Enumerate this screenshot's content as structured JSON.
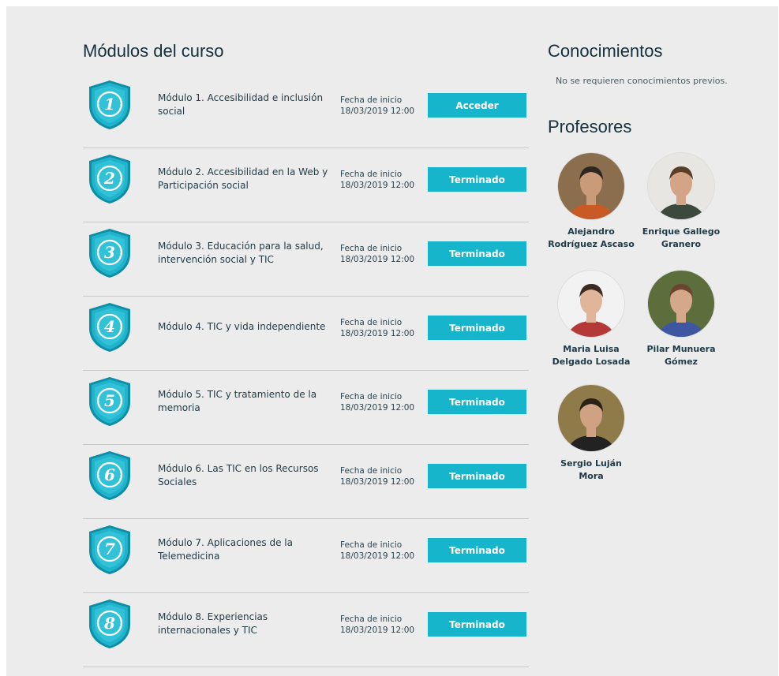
{
  "modules_section": {
    "title": "Módulos del curso",
    "date_label": "Fecha de inicio",
    "modules": [
      {
        "number": "1",
        "title": "Módulo 1. Accesibilidad e inclusión social",
        "date": "18/03/2019 12:00",
        "button": "Acceder"
      },
      {
        "number": "2",
        "title": "Módulo 2. Accesibilidad en la Web y Participación social",
        "date": "18/03/2019 12:00",
        "button": "Terminado"
      },
      {
        "number": "3",
        "title": "Módulo 3. Educación para la salud, intervención social y TIC",
        "date": "18/03/2019 12:00",
        "button": "Terminado"
      },
      {
        "number": "4",
        "title": "Módulo 4. TIC y vida independiente",
        "date": "18/03/2019 12:00",
        "button": "Terminado"
      },
      {
        "number": "5",
        "title": "Módulo 5. TIC y tratamiento de la memoria",
        "date": "18/03/2019 12:00",
        "button": "Terminado"
      },
      {
        "number": "6",
        "title": "Módulo 6. Las TIC en los Recursos Sociales",
        "date": "18/03/2019 12:00",
        "button": "Terminado"
      },
      {
        "number": "7",
        "title": "Módulo 7. Aplicaciones de la Telemedicina",
        "date": "18/03/2019 12:00",
        "button": "Terminado"
      },
      {
        "number": "8",
        "title": "Módulo 8. Experiencias internacionales y TIC",
        "date": "18/03/2019 12:00",
        "button": "Terminado"
      }
    ]
  },
  "knowledge_section": {
    "title": "Conocimientos",
    "text": "No se requieren conocimientos previos."
  },
  "teachers_section": {
    "title": "Profesores",
    "teachers": [
      {
        "name_line1": "Alejandro",
        "name_line2": "Rodríguez Ascaso"
      },
      {
        "name_line1": "Enrique Gallego",
        "name_line2": "Granero"
      },
      {
        "name_line1": "Maria Luisa",
        "name_line2": "Delgado Losada"
      },
      {
        "name_line1": "Pilar Munuera",
        "name_line2": "Gómez"
      },
      {
        "name_line1": "Sergio Luján Mora",
        "name_line2": ""
      }
    ]
  },
  "colors": {
    "accent": "#17b5cc",
    "badge": "#1aa9c2",
    "panel_bg": "#ececec"
  }
}
